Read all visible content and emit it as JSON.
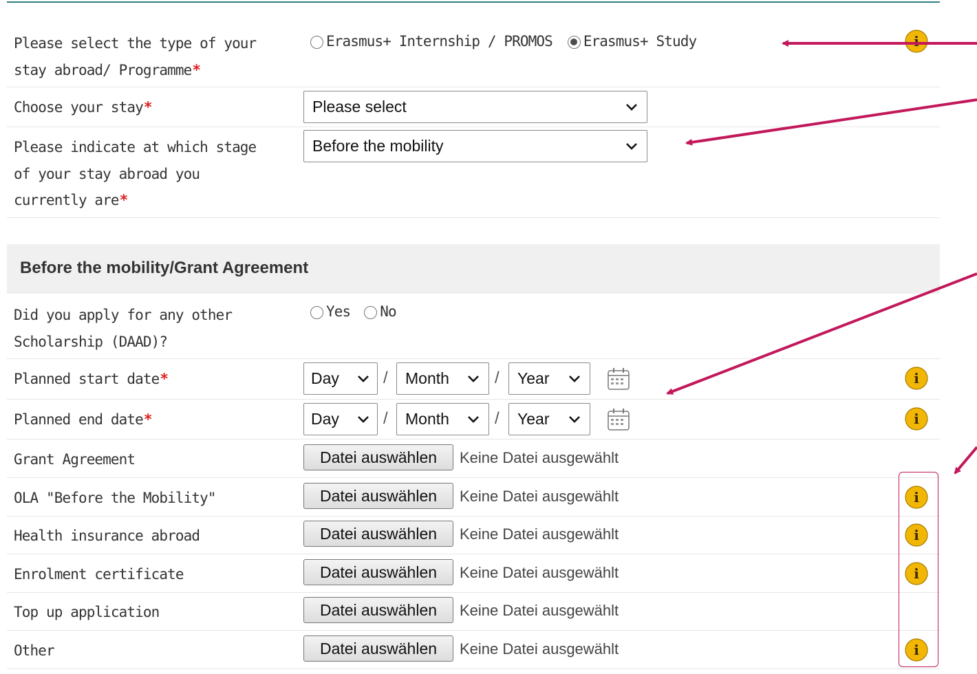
{
  "colors": {
    "accent_rule": "#2f7f86",
    "required": "#e02020",
    "info_icon": "#f2b705",
    "annotation": "#c2185b"
  },
  "programme": {
    "label": "Please select the type of your\nstay abroad/ Programme",
    "required": "*",
    "options": [
      {
        "label": "Erasmus+ Internship / PROMOS",
        "checked": false
      },
      {
        "label": "Erasmus+ Study",
        "checked": true
      }
    ]
  },
  "stay": {
    "label": "Choose your stay",
    "required": "*",
    "value": "Please select"
  },
  "stage": {
    "label": "Please indicate at which stage\nof your stay abroad you\ncurrently are",
    "required": "*",
    "value": "Before the mobility"
  },
  "section": {
    "title": "Before the mobility/Grant Agreement"
  },
  "scholarship": {
    "label": "Did you apply for any other\nScholarship (DAAD)?",
    "options": [
      {
        "label": "Yes",
        "checked": false
      },
      {
        "label": "No",
        "checked": false
      }
    ]
  },
  "start_date": {
    "label": "Planned start date",
    "required": "*",
    "day": "Day",
    "month": "Month",
    "year": "Year",
    "separator": "/"
  },
  "end_date": {
    "label": "Planned end date",
    "required": "*",
    "day": "Day",
    "month": "Month",
    "year": "Year",
    "separator": "/"
  },
  "uploads": [
    {
      "label": "Grant Agreement",
      "button": "Datei auswählen",
      "status": "Keine Datei ausgewählt",
      "info": false
    },
    {
      "label": "OLA \"Before the Mobility\"",
      "button": "Datei auswählen",
      "status": "Keine Datei ausgewählt",
      "info": true
    },
    {
      "label": "Health insurance abroad",
      "button": "Datei auswählen",
      "status": "Keine Datei ausgewählt",
      "info": true
    },
    {
      "label": "Enrolment certificate",
      "button": "Datei auswählen",
      "status": "Keine Datei ausgewählt",
      "info": true
    },
    {
      "label": "Top up application",
      "button": "Datei auswählen",
      "status": "Keine Datei ausgewählt",
      "info": false
    },
    {
      "label": "Other",
      "button": "Datei auswählen",
      "status": "Keine Datei ausgewählt",
      "info": true
    }
  ],
  "icons": {
    "info": "info-circle-icon",
    "calendar": "calendar-icon",
    "chevron": "chevron-down-icon"
  }
}
